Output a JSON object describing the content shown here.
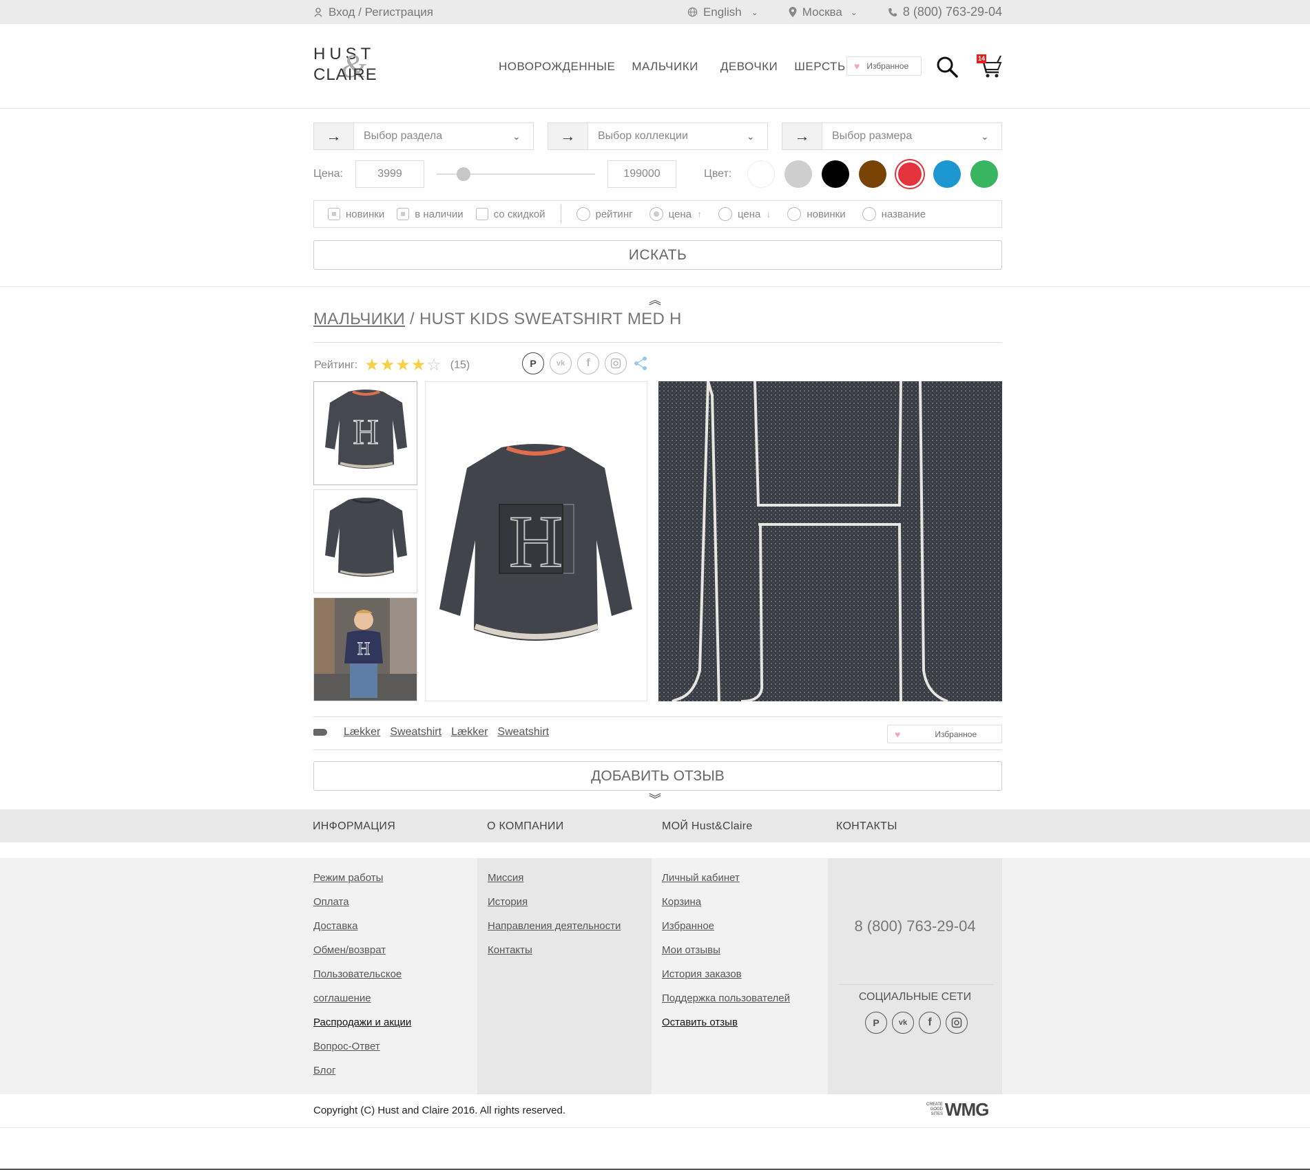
{
  "topbar": {
    "login": "Вход / Регистрация",
    "language": "English",
    "city": "Москва",
    "phone": "8 (800) 763-29-04"
  },
  "header": {
    "logo_top": "HUST",
    "logo_amp": "&",
    "logo_bottom": "CLAIRE",
    "nav": [
      "НОВОРОЖДЕННЫЕ",
      "МАЛЬЧИКИ",
      "ДЕВОЧКИ",
      "ШЕРСТЬ"
    ],
    "favorites": "Избранное",
    "cart_count": "14"
  },
  "filter": {
    "section_placeholder": "Выбор раздела",
    "collection_placeholder": "Выбор коллекции",
    "size_placeholder": "Выбор размера",
    "price_label": "Цена:",
    "price_min": "3999",
    "price_max": "199000",
    "slider_position": 0.06,
    "color_label": "Цвет:",
    "colors": [
      "#ffffff",
      "#cfcfcf",
      "#000000",
      "#7a4306",
      "#e3343d",
      "#1c97d1",
      "#37b561"
    ],
    "selected_color": "#e3343d",
    "checkbox_options": [
      {
        "label": "новинки",
        "checked": true
      },
      {
        "label": "в наличии",
        "checked": true
      },
      {
        "label": "со скидкой",
        "checked": false
      }
    ],
    "sort_options": [
      {
        "label": "рейтинг",
        "selected": false,
        "arrow": ""
      },
      {
        "label": "цена",
        "selected": true,
        "arrow": "↑"
      },
      {
        "label": "цена",
        "selected": false,
        "arrow": "↓"
      },
      {
        "label": "новинки",
        "selected": false,
        "arrow": ""
      },
      {
        "label": "название",
        "selected": false,
        "arrow": ""
      }
    ],
    "search_button": "ИСКАТЬ"
  },
  "product": {
    "breadcrumb_link": "МАЛЬЧИКИ",
    "breadcrumb_sep": " / ",
    "title": "HUST KIDS SWEATSHIRT MED H",
    "rating_label": "Рейтинг:",
    "rating": 4,
    "rating_max": 5,
    "rating_count": "(15)",
    "share_icons": [
      "pinterest-icon",
      "vk-icon",
      "facebook-icon",
      "instagram-icon",
      "share-icon"
    ],
    "tags": [
      "Lækker",
      "Sweatshirt",
      "Lækker",
      "Sweatshirt"
    ],
    "favorites": "Избранное",
    "review_button": "ДОБАВИТЬ ОТЗЫВ"
  },
  "footer": {
    "headers": [
      "ИНФОРМАЦИЯ",
      "О КОМПАНИИ",
      "МОЙ Hust&Claire",
      "КОНТАКТЫ"
    ],
    "info_links": [
      "Режим работы",
      "Оплата",
      "Доставка",
      "Обмен/возврат",
      "Пользовательское",
      "соглашение",
      "Распродажи и акции",
      "Вопрос-Ответ",
      "Блог"
    ],
    "info_strong_index": 6,
    "company_links": [
      "Миссия",
      "История",
      "Направления деятельности",
      "Контакты"
    ],
    "my_links": [
      "Личный кабинет",
      "Корзина",
      "Избранное",
      "Мои отзывы",
      "История заказов",
      "Поддержка пользователей",
      "Оставить отзыв"
    ],
    "my_strong_index": 6,
    "phone": "8 (800) 763-29-04",
    "social_title": "СОЦИАЛЬНЫЕ СЕТИ",
    "copyright": "Copyright (C) Hust and Claire 2016. All rights reserved.",
    "dev_small": [
      "CREATE",
      "GOOD",
      "SITES"
    ],
    "dev_logo": "WMG"
  }
}
